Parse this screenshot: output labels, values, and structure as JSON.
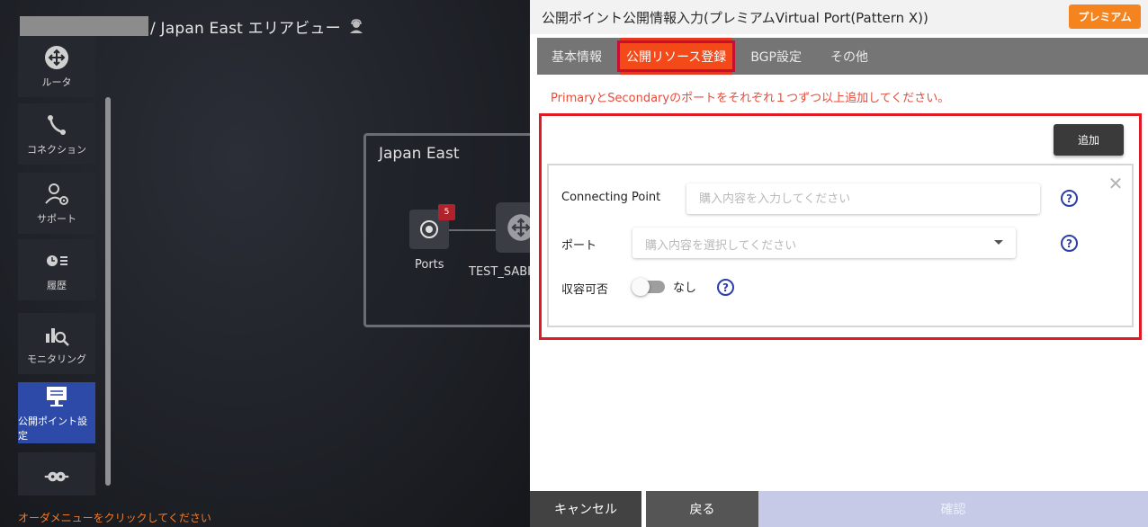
{
  "area_view": {
    "breadcrumb_text": "/ Japan East エリアビュー",
    "sidebar": [
      {
        "label": "ルータ",
        "icon": "router-icon"
      },
      {
        "label": "コネクション",
        "icon": "connection-icon"
      },
      {
        "label": "サポート",
        "icon": "support-icon"
      },
      {
        "label": "履歴",
        "icon": "history-icon"
      },
      {
        "label": "モニタリング",
        "icon": "monitoring-icon"
      },
      {
        "label": "公開ポイント設定",
        "icon": "public-point-icon",
        "active": true
      },
      {
        "label": "",
        "icon": "plug-icon"
      }
    ],
    "region": {
      "title": "Japan East",
      "ports_label": "Ports",
      "ports_badge": "5",
      "router_label": "TEST_SABI"
    },
    "order_hint": "オーダメニューをクリックしてください"
  },
  "panel": {
    "title": "公開ポイント公開情報入力(プレミアムVirtual Port(Pattern X))",
    "premium_label": "プレミアム",
    "tabs": [
      {
        "label": "基本情報",
        "active": false
      },
      {
        "label": "公開リソース登録",
        "active": true
      },
      {
        "label": "BGP設定",
        "active": false
      },
      {
        "label": "その他",
        "active": false
      }
    ],
    "warning": "PrimaryとSecondaryのポートをそれぞれ１つずつ以上追加してください。",
    "add_label": "追加",
    "form": {
      "connecting_point_label": "Connecting Point",
      "connecting_point_placeholder": "購入内容を入力してください",
      "connecting_point_value": "",
      "port_label": "ポート",
      "port_placeholder": "購入内容を選択してください",
      "capacity_label": "収容可否",
      "capacity_toggle_text": "なし",
      "capacity_toggle_on": false
    },
    "footer": {
      "cancel_label": "キャンセル",
      "back_label": "戻る",
      "confirm_label": "確認"
    }
  },
  "colors": {
    "accent_orange": "#f5841f",
    "active_tab": "#e8371f",
    "highlight_red": "#e01b26",
    "warning_text": "#e84a3a",
    "help_blue": "#2b3ea8",
    "sidebar_active": "#2e4aa8",
    "confirm_disabled": "#c6cae6"
  }
}
